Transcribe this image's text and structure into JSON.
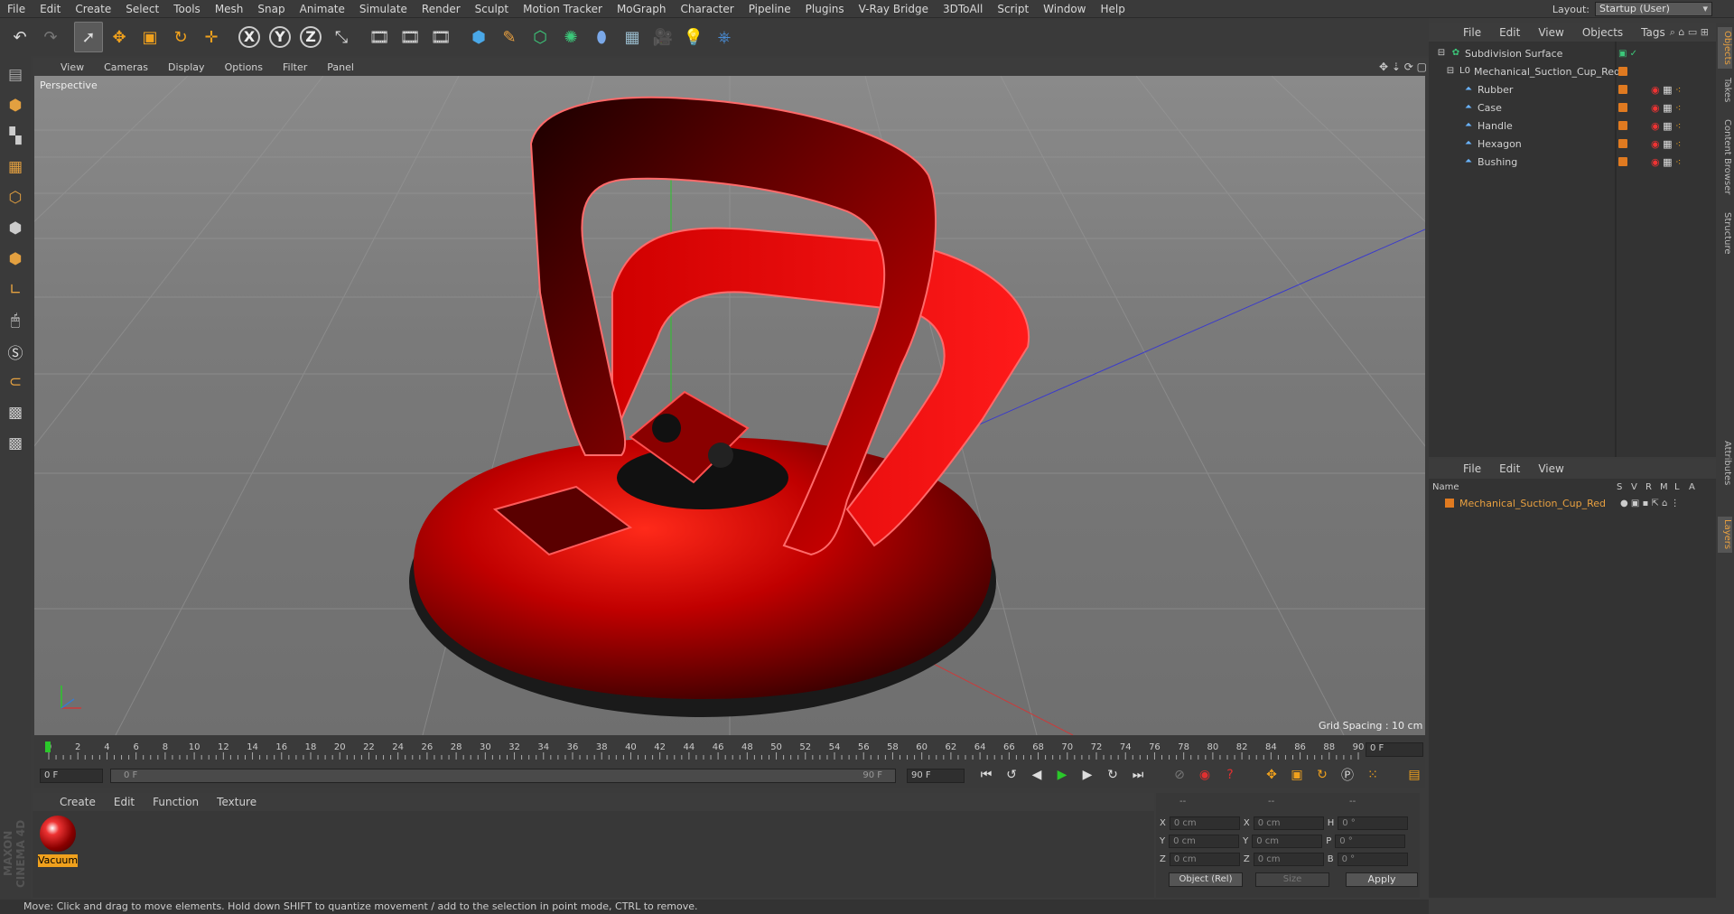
{
  "menubar": [
    "File",
    "Edit",
    "Create",
    "Select",
    "Tools",
    "Mesh",
    "Snap",
    "Animate",
    "Simulate",
    "Render",
    "Sculpt",
    "Motion Tracker",
    "MoGraph",
    "Character",
    "Pipeline",
    "Plugins",
    "V-Ray Bridge",
    "3DToAll",
    "Script",
    "Window",
    "Help"
  ],
  "layout": {
    "label": "Layout:",
    "value": "Startup (User)"
  },
  "toolbar": {
    "undo": "↶",
    "redo": "↷",
    "select": "➚",
    "move": "✥",
    "scale": "▣",
    "rotate": "↻",
    "transform": "✛",
    "x": "X",
    "y": "Y",
    "z": "Z",
    "coord": "⤡",
    "render1": "🎞",
    "render2": "🎞",
    "render3": "🎞",
    "cube": "⬢",
    "pen": "✎",
    "gen": "⬡",
    "deform": "✺",
    "spline": "⬮",
    "floor": "▦",
    "camera": "🎥",
    "light": "💡",
    "python": "⎈"
  },
  "viewport_menu": [
    "View",
    "Cameras",
    "Display",
    "Options",
    "Filter",
    "Panel"
  ],
  "viewport": {
    "label": "Perspective",
    "grid_spacing": "Grid Spacing : 10 cm"
  },
  "timeline": {
    "ticks": [
      "0",
      "2",
      "4",
      "6",
      "8",
      "10",
      "12",
      "14",
      "16",
      "18",
      "20",
      "22",
      "24",
      "26",
      "28",
      "30",
      "32",
      "34",
      "36",
      "38",
      "40",
      "42",
      "44",
      "46",
      "48",
      "50",
      "52",
      "54",
      "56",
      "58",
      "60",
      "62",
      "64",
      "66",
      "68",
      "70",
      "72",
      "74",
      "76",
      "78",
      "80",
      "82",
      "84",
      "86",
      "88",
      "90"
    ],
    "current": "0 F"
  },
  "transport": {
    "start": "0 F",
    "slider_start": "0 F",
    "slider_end": "90 F",
    "end": "90 F"
  },
  "material_menu": [
    "Create",
    "Edit",
    "Function",
    "Texture"
  ],
  "material": {
    "name": "Vacuum"
  },
  "coords": {
    "header1": "--",
    "header2": "--",
    "header3": "--",
    "rows": [
      {
        "a": "X",
        "v1": "0 cm",
        "b": "X",
        "v2": "0 cm",
        "c": "H",
        "v3": "0 °"
      },
      {
        "a": "Y",
        "v1": "0 cm",
        "b": "Y",
        "v2": "0 cm",
        "c": "P",
        "v3": "0 °"
      },
      {
        "a": "Z",
        "v1": "0 cm",
        "b": "Z",
        "v2": "0 cm",
        "c": "B",
        "v3": "0 °"
      }
    ],
    "mode": "Object (Rel)",
    "size": "Size",
    "apply": "Apply"
  },
  "status": "Move: Click and drag to move elements. Hold down SHIFT to quantize movement / add to the selection in point mode, CTRL to remove.",
  "object_menu": [
    "File",
    "Edit",
    "View",
    "Objects",
    "Tags"
  ],
  "objects": [
    {
      "name": "Subdivision Surface",
      "indent": 0
    },
    {
      "name": "Mechanical_Suction_Cup_Red",
      "indent": 1
    },
    {
      "name": "Rubber",
      "indent": 2
    },
    {
      "name": "Case",
      "indent": 2
    },
    {
      "name": "Handle",
      "indent": 2
    },
    {
      "name": "Hexagon",
      "indent": 2
    },
    {
      "name": "Bushing",
      "indent": 2
    }
  ],
  "layer_menu": [
    "File",
    "Edit",
    "View"
  ],
  "layer_header": {
    "name": "Name",
    "cols": [
      "S",
      "V",
      "R",
      "M",
      "L",
      "A"
    ]
  },
  "layer": {
    "name": "Mechanical_Suction_Cup_Red"
  },
  "side_tabs": [
    "Objects",
    "Takes",
    "Content Browser",
    "Structure",
    "Attributes",
    "Layers"
  ],
  "maxon": "MAXON CINEMA 4D",
  "colors": {
    "accent": "#f0a11d",
    "model_red": "#c40000",
    "layer_text": "#e8a040"
  }
}
